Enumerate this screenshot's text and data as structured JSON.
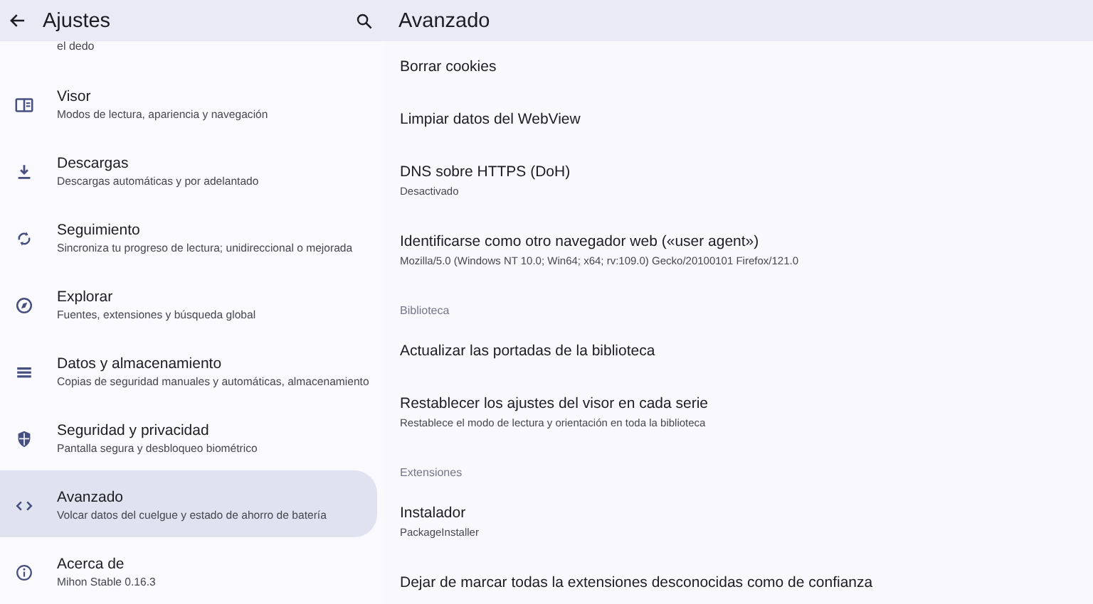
{
  "sidebar": {
    "title": "Ajustes",
    "partial_subtitle": "el dedo",
    "items": [
      {
        "title": "Visor",
        "subtitle": "Modos de lectura, apariencia y navegación",
        "selected": false
      },
      {
        "title": "Descargas",
        "subtitle": "Descargas automáticas y por adelantado",
        "selected": false
      },
      {
        "title": "Seguimiento",
        "subtitle": "Sincroniza tu progreso de lectura; unidireccional o mejorada",
        "selected": false
      },
      {
        "title": "Explorar",
        "subtitle": "Fuentes, extensiones y búsqueda global",
        "selected": false
      },
      {
        "title": "Datos y almacenamiento",
        "subtitle": "Copias de seguridad manuales y automáticas, almacenamiento",
        "selected": false
      },
      {
        "title": "Seguridad y privacidad",
        "subtitle": "Pantalla segura y desbloqueo biométrico",
        "selected": false
      },
      {
        "title": "Avanzado",
        "subtitle": "Volcar datos del cuelgue y estado de ahorro de batería",
        "selected": true
      },
      {
        "title": "Acerca de",
        "subtitle": "Mihon Stable 0.16.3",
        "selected": false
      }
    ]
  },
  "detail": {
    "title": "Avanzado",
    "items": [
      {
        "kind": "item",
        "title": "Borrar cookies"
      },
      {
        "kind": "item",
        "title": "Limpiar datos del WebView"
      },
      {
        "kind": "item",
        "title": "DNS sobre HTTPS (DoH)",
        "subtitle": "Desactivado"
      },
      {
        "kind": "item",
        "title": "Identificarse como otro navegador web («user agent»)",
        "subtitle": "Mozilla/5.0 (Windows NT 10.0; Win64; x64; rv:109.0) Gecko/20100101 Firefox/121.0"
      },
      {
        "kind": "header",
        "title": "Biblioteca"
      },
      {
        "kind": "item",
        "title": "Actualizar las portadas de la biblioteca"
      },
      {
        "kind": "item",
        "title": "Restablecer los ajustes del visor en cada serie",
        "subtitle": "Restablece el modo de lectura y orientación en toda la biblioteca"
      },
      {
        "kind": "header",
        "title": "Extensiones"
      },
      {
        "kind": "item",
        "title": "Instalador",
        "subtitle": "PackageInstaller"
      },
      {
        "kind": "item",
        "title": "Dejar de marcar todas la extensiones desconocidas como de confianza"
      }
    ]
  }
}
